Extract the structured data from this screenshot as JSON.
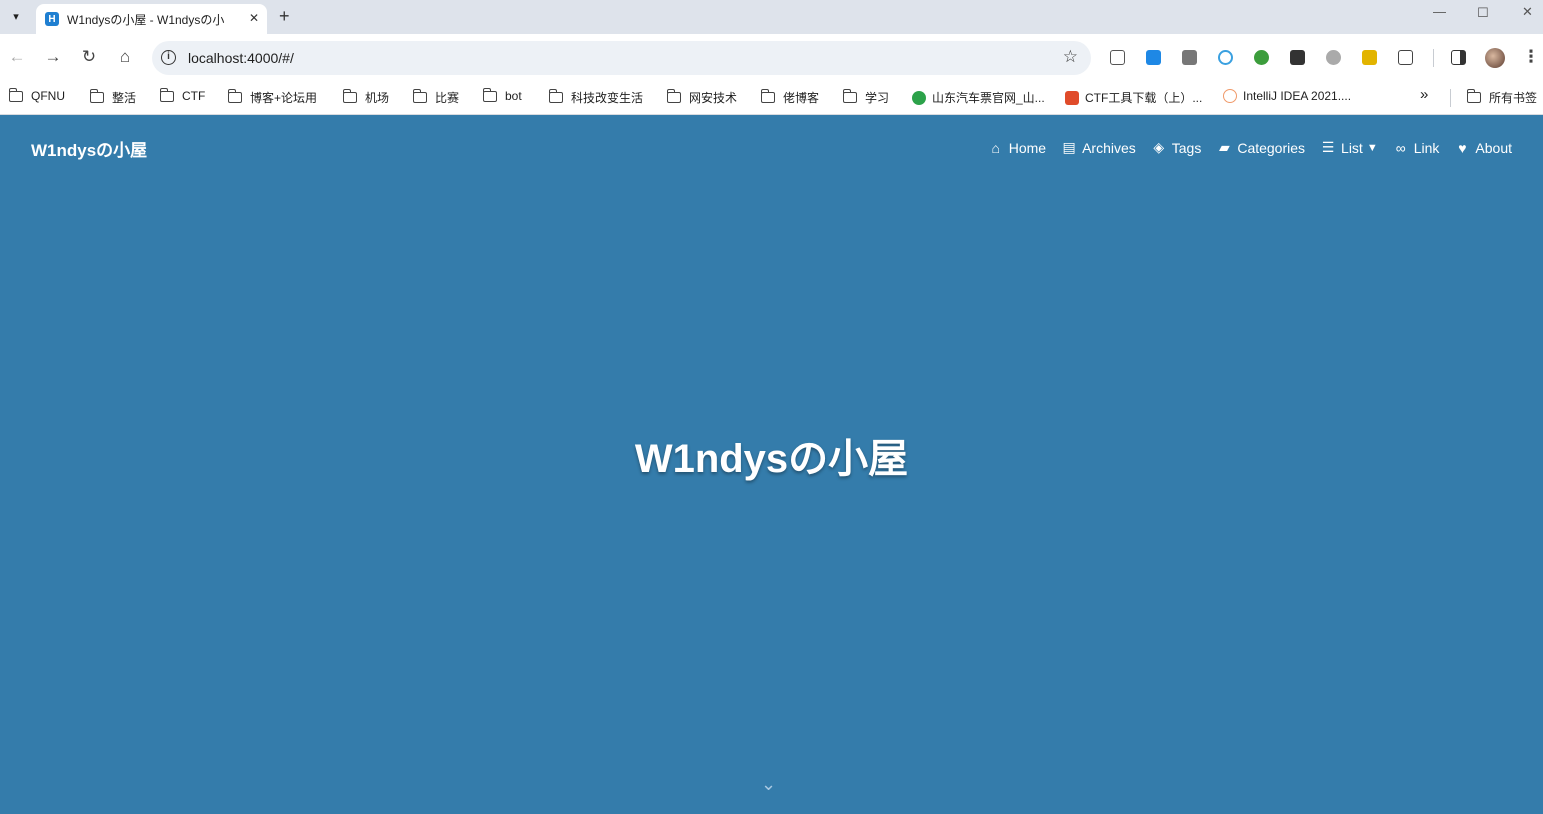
{
  "browser": {
    "tab_title": "W1ndysの小屋 - W1ndysの小",
    "tab_favicon": "H",
    "url": "localhost:4000/#/",
    "new_tab_icon": "+",
    "bookmarks": [
      {
        "label": "QFNU",
        "type": "folder"
      },
      {
        "label": "整活",
        "type": "folder"
      },
      {
        "label": "CTF",
        "type": "folder"
      },
      {
        "label": "博客+论坛用",
        "type": "folder"
      },
      {
        "label": "机场",
        "type": "folder"
      },
      {
        "label": "比赛",
        "type": "folder"
      },
      {
        "label": "bot",
        "type": "folder"
      },
      {
        "label": "科技改变生活",
        "type": "folder"
      },
      {
        "label": "网安技术",
        "type": "folder"
      },
      {
        "label": "佬博客",
        "type": "folder"
      },
      {
        "label": "学习",
        "type": "folder"
      },
      {
        "label": "山东汽车票官网_山...",
        "type": "link"
      },
      {
        "label": "CTF工具下载（上）...",
        "type": "link"
      },
      {
        "label": "IntelliJ IDEA 2021....",
        "type": "link"
      }
    ],
    "bookmarks_overflow": "»",
    "all_bookmarks": "所有书签"
  },
  "site": {
    "brand": "W1ndysの小屋",
    "nav": [
      {
        "label": "Home",
        "icon": "home-icon"
      },
      {
        "label": "Archives",
        "icon": "archive-icon"
      },
      {
        "label": "Tags",
        "icon": "tags-icon"
      },
      {
        "label": "Categories",
        "icon": "folder-open-icon"
      },
      {
        "label": "List",
        "icon": "list-icon"
      },
      {
        "label": "Link",
        "icon": "link-icon"
      },
      {
        "label": "About",
        "icon": "heart-icon"
      }
    ],
    "hero_title": "W1ndysの小屋"
  },
  "colors": {
    "page_background": "#347cab",
    "text": "#ffffff"
  }
}
